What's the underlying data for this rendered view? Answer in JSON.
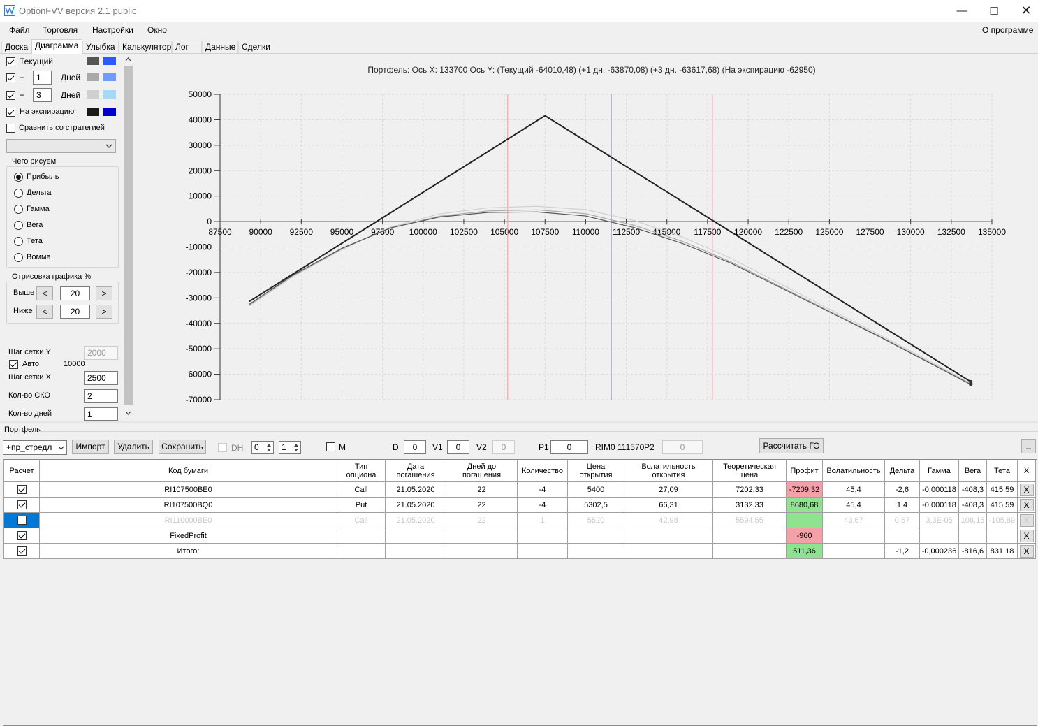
{
  "window": {
    "title": "OptionFVV версия 2.1 public"
  },
  "menu": {
    "items": [
      "Файл",
      "Торговля",
      "Настройки",
      "Окно"
    ],
    "about": "О программе"
  },
  "tabs": [
    "Доска",
    "Диаграмма",
    "Улыбка",
    "Калькулятор",
    "Лог",
    "Данные",
    "Сделки"
  ],
  "left_panel": {
    "series": [
      {
        "label": "Текущий",
        "checked": true,
        "color1": "#555555",
        "color2": "#2b5bff"
      },
      {
        "prefix": "+",
        "days": "1",
        "unit": "Дней",
        "checked": true,
        "color1": "#a9a9a9",
        "color2": "#6f9bff"
      },
      {
        "prefix": "+",
        "days": "3",
        "unit": "Дней",
        "checked": true,
        "color1": "#d0d0d0",
        "color2": "#a8d8f8"
      },
      {
        "label": "На экспирацию",
        "checked": true,
        "color1": "#1a1a1a",
        "color2": "#0000c8"
      }
    ],
    "compare_label": "Сравнить со стратегией",
    "draw_group_title": "Чего рисуем",
    "draw_options": [
      "Прибыль",
      "Дельта",
      "Гамма",
      "Вега",
      "Тета",
      "Вомма"
    ],
    "draw_selected": "Прибыль",
    "range_group_title": "Отрисовка графика %",
    "above_label": "Выше",
    "above_value": "20",
    "below_label": "Ниже",
    "below_value": "20",
    "left_arrow": "<",
    "right_arrow": ">",
    "grid_y_label": "Шаг сетки Y",
    "grid_y_value": "2000",
    "auto_label": "Авто",
    "auto_value": "10000",
    "grid_x_label": "Шаг сетки X",
    "grid_x_value": "2500",
    "sko_label": "Кол-во СКО",
    "sko_value": "2",
    "days_label": "Кол-во дней",
    "days_value": "1"
  },
  "chart_data": {
    "type": "line",
    "title": "Портфель: Ось X:  133700 Ось Y:  (Текущий -64010,48)  (+1 дн. -63870,08)  (+3 дн. -63617,68)  (На экспирацию -62950)",
    "xlim": [
      87500,
      135000
    ],
    "ylim": [
      -70000,
      50000
    ],
    "x_ticks": [
      87500,
      90000,
      92500,
      95000,
      97500,
      100000,
      102500,
      105000,
      107500,
      110000,
      112500,
      115000,
      117500,
      120000,
      122500,
      125000,
      127500,
      130000,
      132500,
      135000
    ],
    "y_ticks": [
      50000,
      40000,
      30000,
      20000,
      10000,
      0,
      -10000,
      -20000,
      -30000,
      -40000,
      -50000,
      -60000,
      -70000
    ],
    "grid": true,
    "vlines": [
      {
        "x": 105200,
        "color": "#f4a7a7"
      },
      {
        "x": 111570,
        "color": "#8888aa"
      },
      {
        "x": 117800,
        "color": "#f4a7a7"
      }
    ],
    "series": [
      {
        "color": "#222222",
        "width": 2,
        "x": [
          89300,
          107500,
          133700
        ],
        "y": [
          -31400,
          41600,
          -62950
        ]
      },
      {
        "color": "#555555",
        "width": 1.2,
        "x": [
          89300,
          92000,
          95000,
          98000,
          101000,
          104000,
          107000,
          110000,
          113000,
          116000,
          119000,
          122000,
          125000,
          128000,
          131000,
          133700
        ],
        "y": [
          -32500,
          -21000,
          -10500,
          -2500,
          1800,
          3600,
          3800,
          2200,
          -2400,
          -8700,
          -16500,
          -26000,
          -35500,
          -45000,
          -55000,
          -64010
        ]
      },
      {
        "color": "#a9a9a9",
        "width": 1.2,
        "x": [
          89300,
          92000,
          95000,
          98000,
          101000,
          104000,
          107000,
          110000,
          113000,
          116000,
          119000,
          122000,
          125000,
          128000,
          131000,
          133700
        ],
        "y": [
          -32800,
          -21200,
          -10700,
          -2400,
          2100,
          4200,
          4600,
          3100,
          -1500,
          -7900,
          -16000,
          -25600,
          -35200,
          -44800,
          -54800,
          -63870
        ]
      },
      {
        "color": "#d0d0d0",
        "width": 1.2,
        "x": [
          89300,
          92000,
          95000,
          98000,
          101000,
          104000,
          107000,
          110000,
          113000,
          116000,
          119000,
          122000,
          125000,
          128000,
          131000,
          133700
        ],
        "y": [
          -33200,
          -21600,
          -11000,
          -2200,
          3000,
          5400,
          6000,
          4700,
          400,
          -6200,
          -14600,
          -24500,
          -34400,
          -44200,
          -54300,
          -63617
        ]
      }
    ]
  },
  "portfolio": {
    "title": "Портфель",
    "strategy": "+пр_стредл",
    "import_label": "Импорт",
    "delete_label": "Удалить",
    "save_label": "Сохранить",
    "dh_label": "DH",
    "spin1": "0",
    "spin2": "1",
    "m_label": "M",
    "d_label": "D",
    "d_value": "0",
    "v1_label": "V1",
    "v1_value": "0",
    "v2_label": "V2",
    "v2_value": "0",
    "p1_label": "P1",
    "p1_value": "0",
    "rim_label": "RIM0 111570",
    "p2_label": "P2",
    "p2_value": "0",
    "calc_go_label": "Рассчитать ГО",
    "extra_label": "_"
  },
  "table": {
    "columns": [
      "Расчет",
      "Код бумаги",
      "Тип опциона",
      "Дата погашения",
      "Дней до погашения",
      "Количество",
      "Цена открытия",
      "Волатильность открытия",
      "Теоретическая цена",
      "Профит",
      "Волатильность",
      "Дельта",
      "Гамма",
      "Вега",
      "Тета",
      "X"
    ],
    "rows": [
      {
        "checked": true,
        "code": "RI107500BE0",
        "type": "Call",
        "date": "21.05.2020",
        "days": "22",
        "qty": "-4",
        "price": "5400",
        "vol_open": "27,09",
        "theo": "7202,33",
        "profit": "-7209,32",
        "profit_color": "red",
        "vol": "45,4",
        "delta": "-2,6",
        "gamma": "-0,000118",
        "vega": "-408,3",
        "theta": "415,59",
        "x": "X"
      },
      {
        "checked": true,
        "code": "RI107500BQ0",
        "type": "Put",
        "date": "21.05.2020",
        "days": "22",
        "qty": "-4",
        "price": "5302,5",
        "vol_open": "66,31",
        "theo": "3132,33",
        "profit": "8680,68",
        "profit_color": "green",
        "vol": "45,4",
        "delta": "1,4",
        "gamma": "-0,000118",
        "vega": "-408,3",
        "theta": "415,59",
        "x": "X"
      },
      {
        "checked": false,
        "disabled": true,
        "selected": true,
        "code": "RI110000BE0",
        "type": "Call",
        "date": "21.05.2020",
        "days": "22",
        "qty": "1",
        "price": "5520",
        "vol_open": "42,98",
        "theo": "5594,55",
        "profit": "",
        "profit_color": "green",
        "vol": "43,67",
        "delta": "0,57",
        "gamma": "3,3E-05",
        "vega": "108,15",
        "theta": "-105,89",
        "x": "X"
      },
      {
        "checked": true,
        "code": "FixedProfit",
        "type": "",
        "date": "",
        "days": "",
        "qty": "",
        "price": "",
        "vol_open": "",
        "theo": "",
        "profit": "-960",
        "profit_color": "red",
        "vol": "",
        "delta": "",
        "gamma": "",
        "vega": "",
        "theta": "",
        "x": "X"
      },
      {
        "checked": true,
        "code": "Итого:",
        "type": "",
        "date": "",
        "days": "",
        "qty": "",
        "price": "",
        "vol_open": "",
        "theo": "",
        "profit": "511,36",
        "profit_color": "green",
        "vol": "",
        "delta": "-1,2",
        "gamma": "-0,000236",
        "vega": "-816,6",
        "theta": "831,18",
        "x": "X"
      }
    ]
  }
}
